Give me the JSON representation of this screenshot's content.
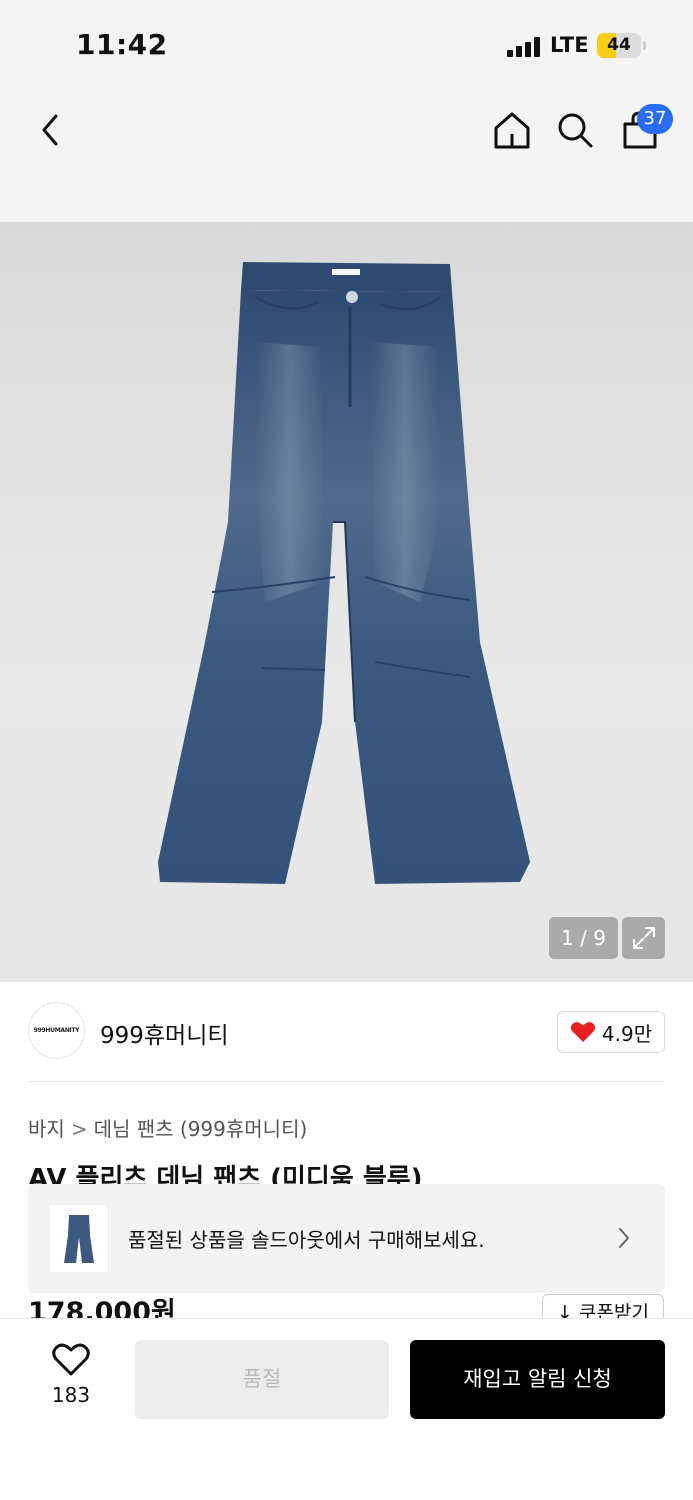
{
  "status_bar": {
    "time": "11:42",
    "network": "LTE",
    "battery": "44",
    "battery_level": 0.44
  },
  "nav": {
    "back_icon": "chevron-left-icon",
    "home_icon": "home-icon",
    "search_icon": "search-icon",
    "cart_icon": "shopping-bag-icon",
    "cart_count": "37",
    "badge_color": "#2a6cf4"
  },
  "gallery": {
    "counter": "1 / 9",
    "expand_icon": "expand-icon",
    "image": "denim-jeans"
  },
  "brand": {
    "logo_text": "999HUMANITY",
    "name": "999휴머니티",
    "likes": "4.9만",
    "heart_color": "#e8201f"
  },
  "breadcrumb": {
    "category": "바지",
    "subcategory": "데님 팬츠 (999휴머니티)"
  },
  "product": {
    "title": "AV 플리츠 데님 팬츠 (미디움 블루)",
    "price": "178,000원",
    "coupon_label": "↓ 쿠폰받기"
  },
  "soldout_banner": {
    "text": "품절된 상품을 솔드아웃에서 구매해보세요."
  },
  "bottom_bar": {
    "wish_count": "183",
    "soldout_label": "품절",
    "restock_label": "재입고 알림 신청"
  }
}
